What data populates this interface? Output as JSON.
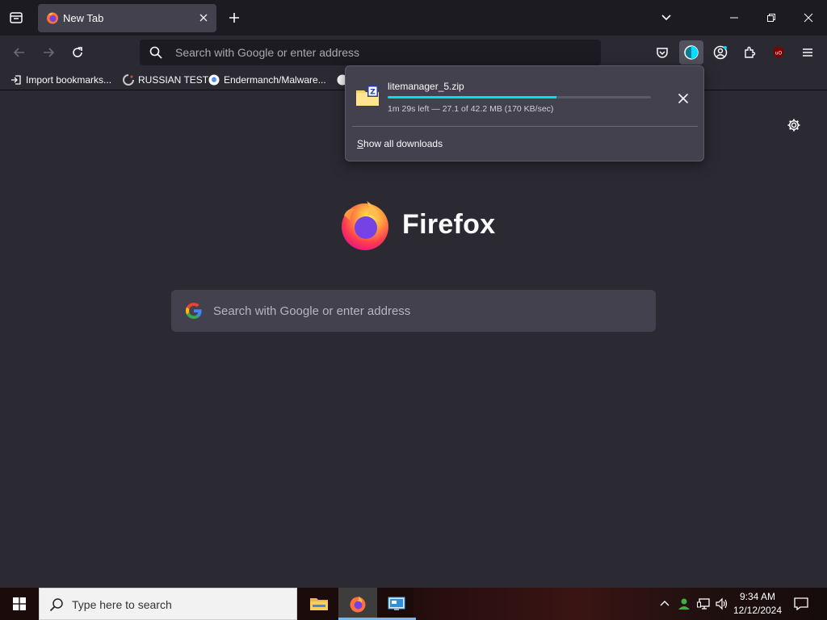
{
  "browser": {
    "tab": {
      "title": "New Tab"
    },
    "urlbar": {
      "placeholder": "Search with Google or enter address"
    },
    "bookmarks": [
      {
        "label": "Import bookmarks...",
        "icon": "import-icon"
      },
      {
        "label": "RUSSIAN TEST",
        "icon": "site-favicon"
      },
      {
        "label": "Endermanch/Malware...",
        "icon": "google-favicon"
      }
    ]
  },
  "downloads_panel": {
    "file_name": "litemanager_5.zip",
    "status": "1m 29s left — 27.1 of 42.2 MB (170 KB/sec)",
    "progress_fraction": 0.642,
    "show_all_prefix": "S",
    "show_all_rest": "how all downloads"
  },
  "newtab": {
    "brand": "Firefox",
    "search_placeholder": "Search with Google or enter address"
  },
  "taskbar": {
    "search_placeholder": "Type here to search",
    "apps": [
      "file-explorer-icon",
      "firefox-icon",
      "remote-control-app-icon"
    ],
    "time": "9:34 AM",
    "date": "12/12/2024"
  },
  "colors": {
    "accent": "#00ddff",
    "toolbar": "#2b2a33",
    "tabstrip": "#1c1b22"
  }
}
